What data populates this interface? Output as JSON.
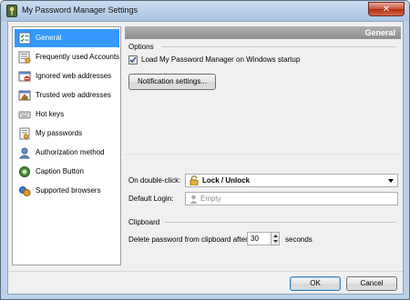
{
  "window": {
    "title": "My Password Manager Settings",
    "close_label": "✕"
  },
  "sidebar": {
    "items": [
      {
        "label": "General",
        "icon": "general-settings-icon"
      },
      {
        "label": "Frequently used Accounts",
        "icon": "accounts-icon"
      },
      {
        "label": "Ignored web addresses",
        "icon": "ignored-addresses-icon"
      },
      {
        "label": "Trusted web addresses",
        "icon": "trusted-addresses-icon"
      },
      {
        "label": "Hot keys",
        "icon": "keyboard-icon"
      },
      {
        "label": "My passwords",
        "icon": "passwords-icon"
      },
      {
        "label": "Authorization method",
        "icon": "authorization-icon"
      },
      {
        "label": "Caption Button",
        "icon": "caption-button-icon"
      },
      {
        "label": "Supported browsers",
        "icon": "browsers-icon"
      }
    ],
    "selected_index": 0
  },
  "header": {
    "title": "General"
  },
  "options": {
    "section_label": "Options",
    "startup_checkbox_label": "Load My Password Manager on Windows startup",
    "startup_checked": true,
    "notification_button": "Notification settings..."
  },
  "double_click": {
    "label": "On double-click:",
    "value": "Lock / Unlock"
  },
  "default_login": {
    "label": "Default Login:",
    "placeholder": "Empty"
  },
  "clipboard": {
    "section_label": "Clipboard",
    "delete_label": "Delete password from clipboard after",
    "seconds_value": "30",
    "seconds_unit": "seconds"
  },
  "footer": {
    "ok_label": "OK",
    "cancel_label": "Cancel"
  },
  "colors": {
    "selection": "#3399ff",
    "header_bar": "#9a9a9a",
    "titlebar": "#b9d1ea",
    "close_button": "#c85037"
  }
}
